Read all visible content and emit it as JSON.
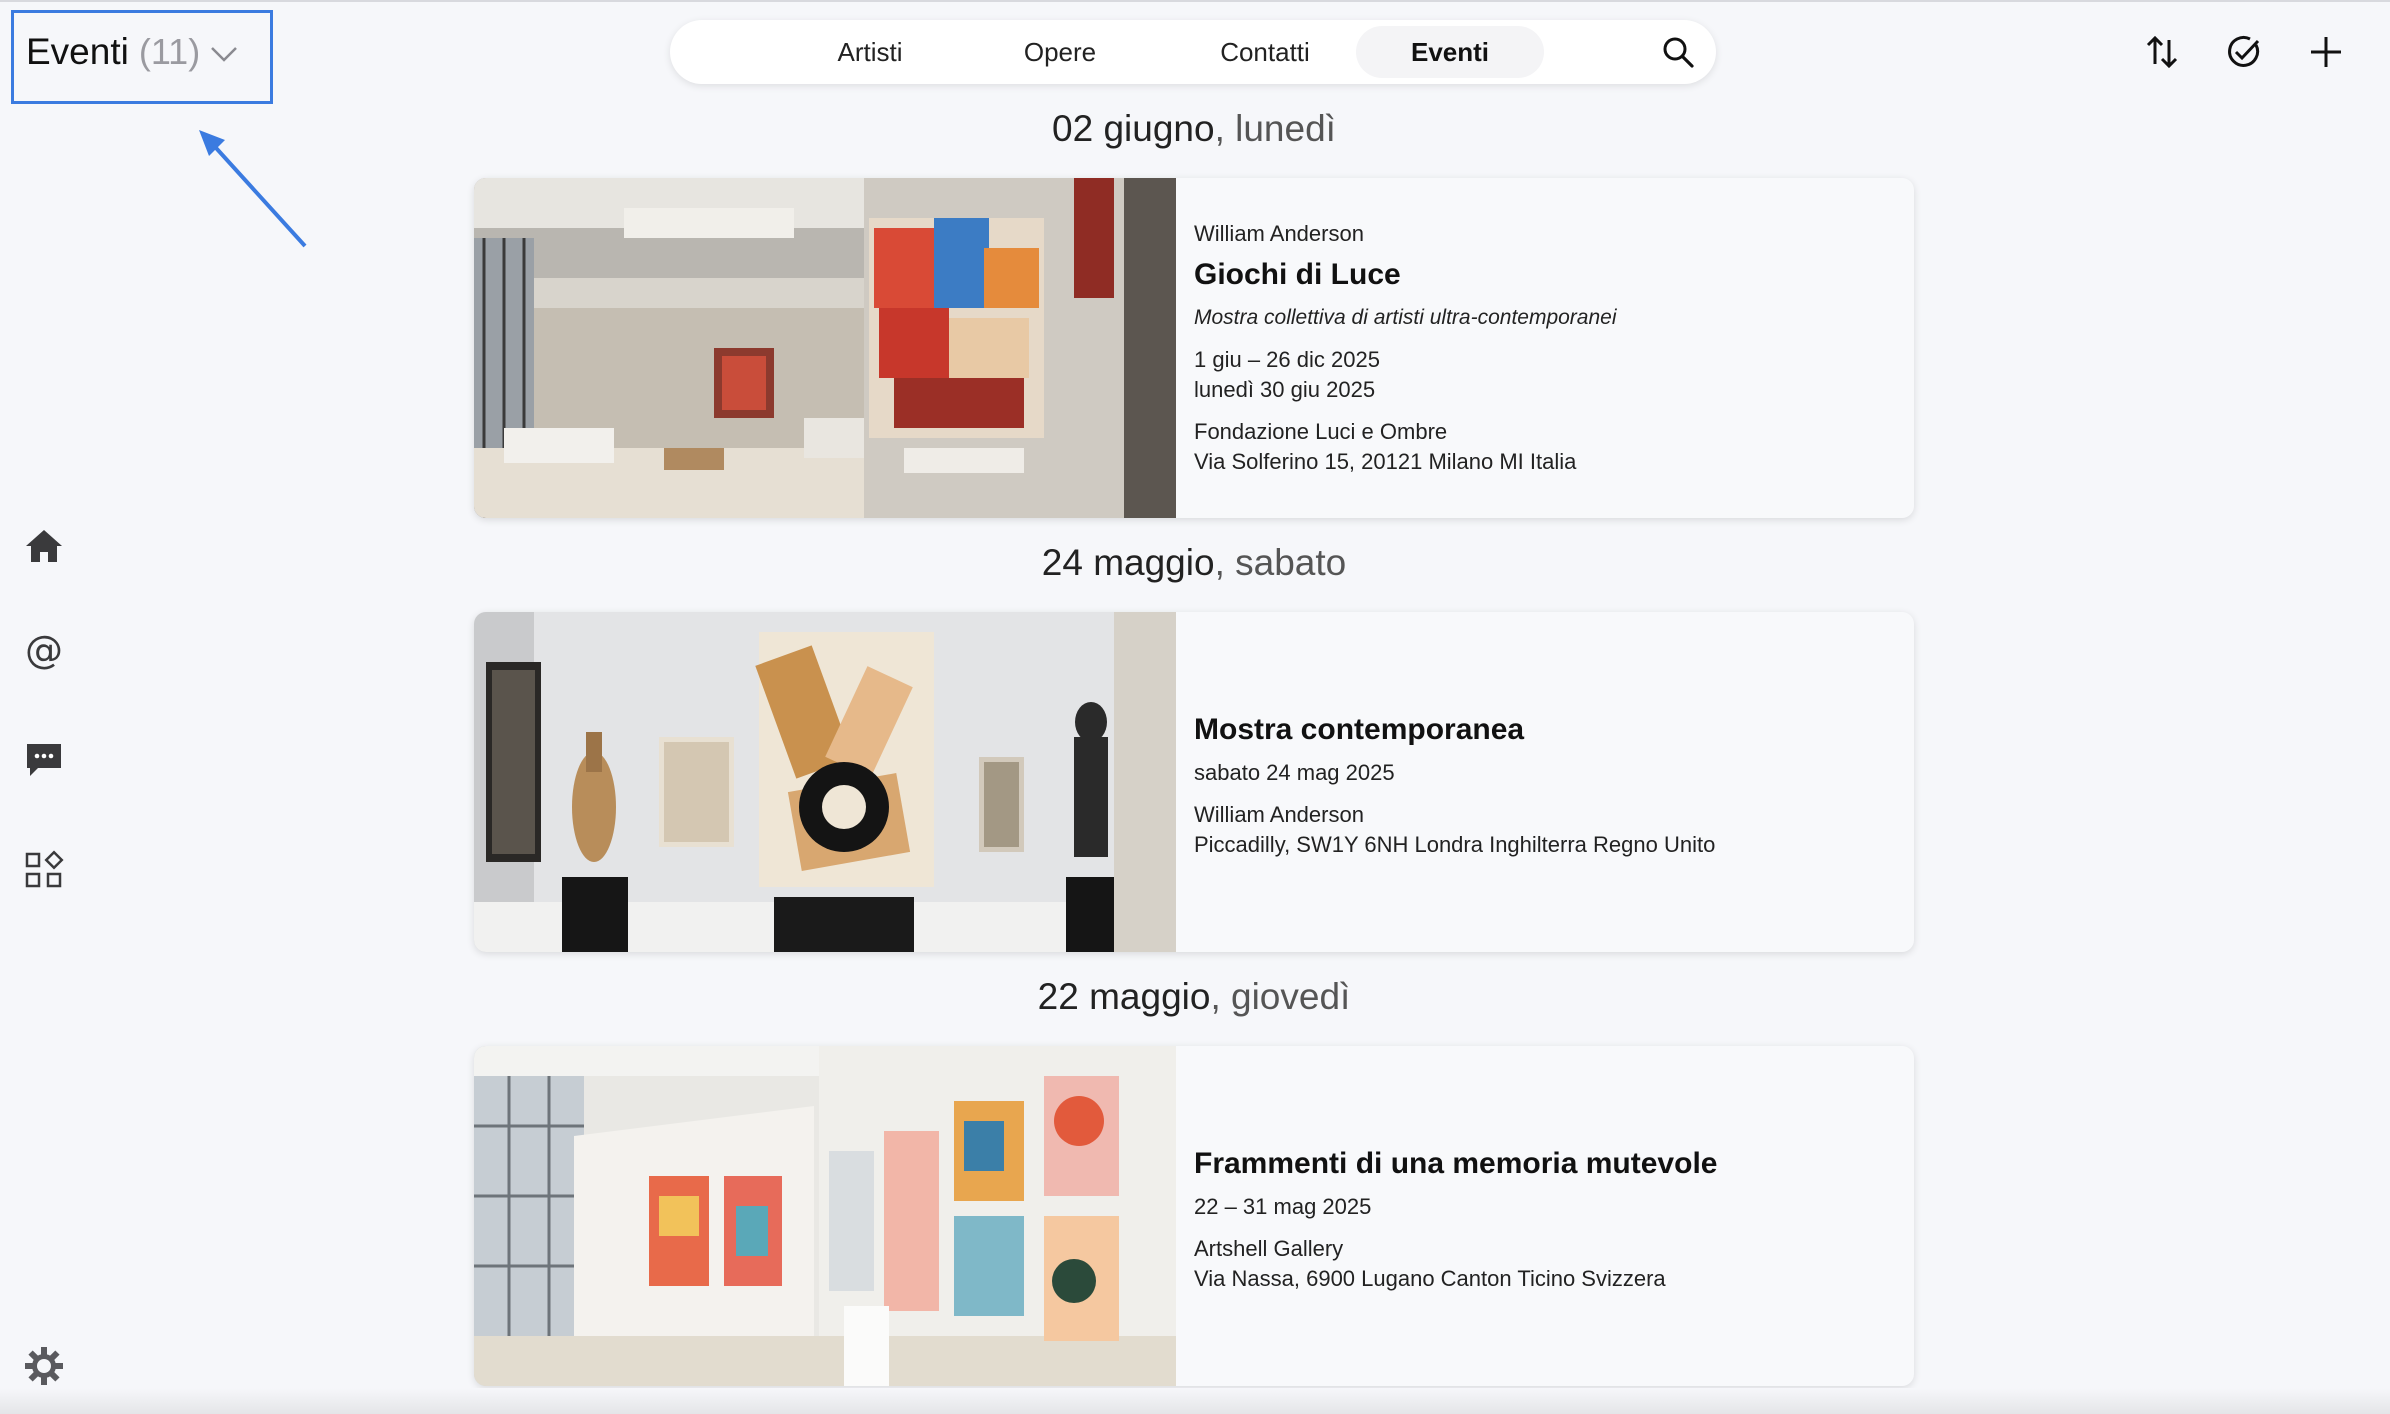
{
  "header": {
    "title": "Eventi",
    "count": "(11)"
  },
  "nav": {
    "tabs": [
      "Artisti",
      "Opere",
      "Contatti",
      "Eventi"
    ],
    "active": "Eventi"
  },
  "toolbar": {
    "icons": [
      "sort-icon",
      "check-circle-icon",
      "plus-icon"
    ]
  },
  "sidebar": {
    "icons": [
      "home-icon",
      "at-icon",
      "chat-icon",
      "apps-icon",
      "settings-icon"
    ]
  },
  "events": [
    {
      "date": "02 giugno",
      "weekday": ", lunedì",
      "artist": "William Anderson",
      "title": "Giochi di Luce",
      "subtitle": "Mostra collettiva di artisti ultra-contemporanei",
      "dates": "1 giu – 26 dic 2025",
      "day": "lunedì 30 giu 2025",
      "venue": "Fondazione Luci e Ombre",
      "address": "Via Solferino 15, 20121 Milano MI Italia"
    },
    {
      "date": "24 maggio",
      "weekday": ", sabato",
      "title": "Mostra contemporanea",
      "day": "sabato 24 mag 2025",
      "artist": "William Anderson",
      "address": "Piccadilly, SW1Y 6NH Londra Inghilterra Regno Unito"
    },
    {
      "date": "22 maggio",
      "weekday": ", giovedì",
      "title": "Frammenti di una memoria mutevole",
      "dates": "22 – 31 mag 2025",
      "venue": "Artshell Gallery",
      "address": "Via Nassa, 6900 Lugano Canton Ticino Svizzera"
    }
  ]
}
